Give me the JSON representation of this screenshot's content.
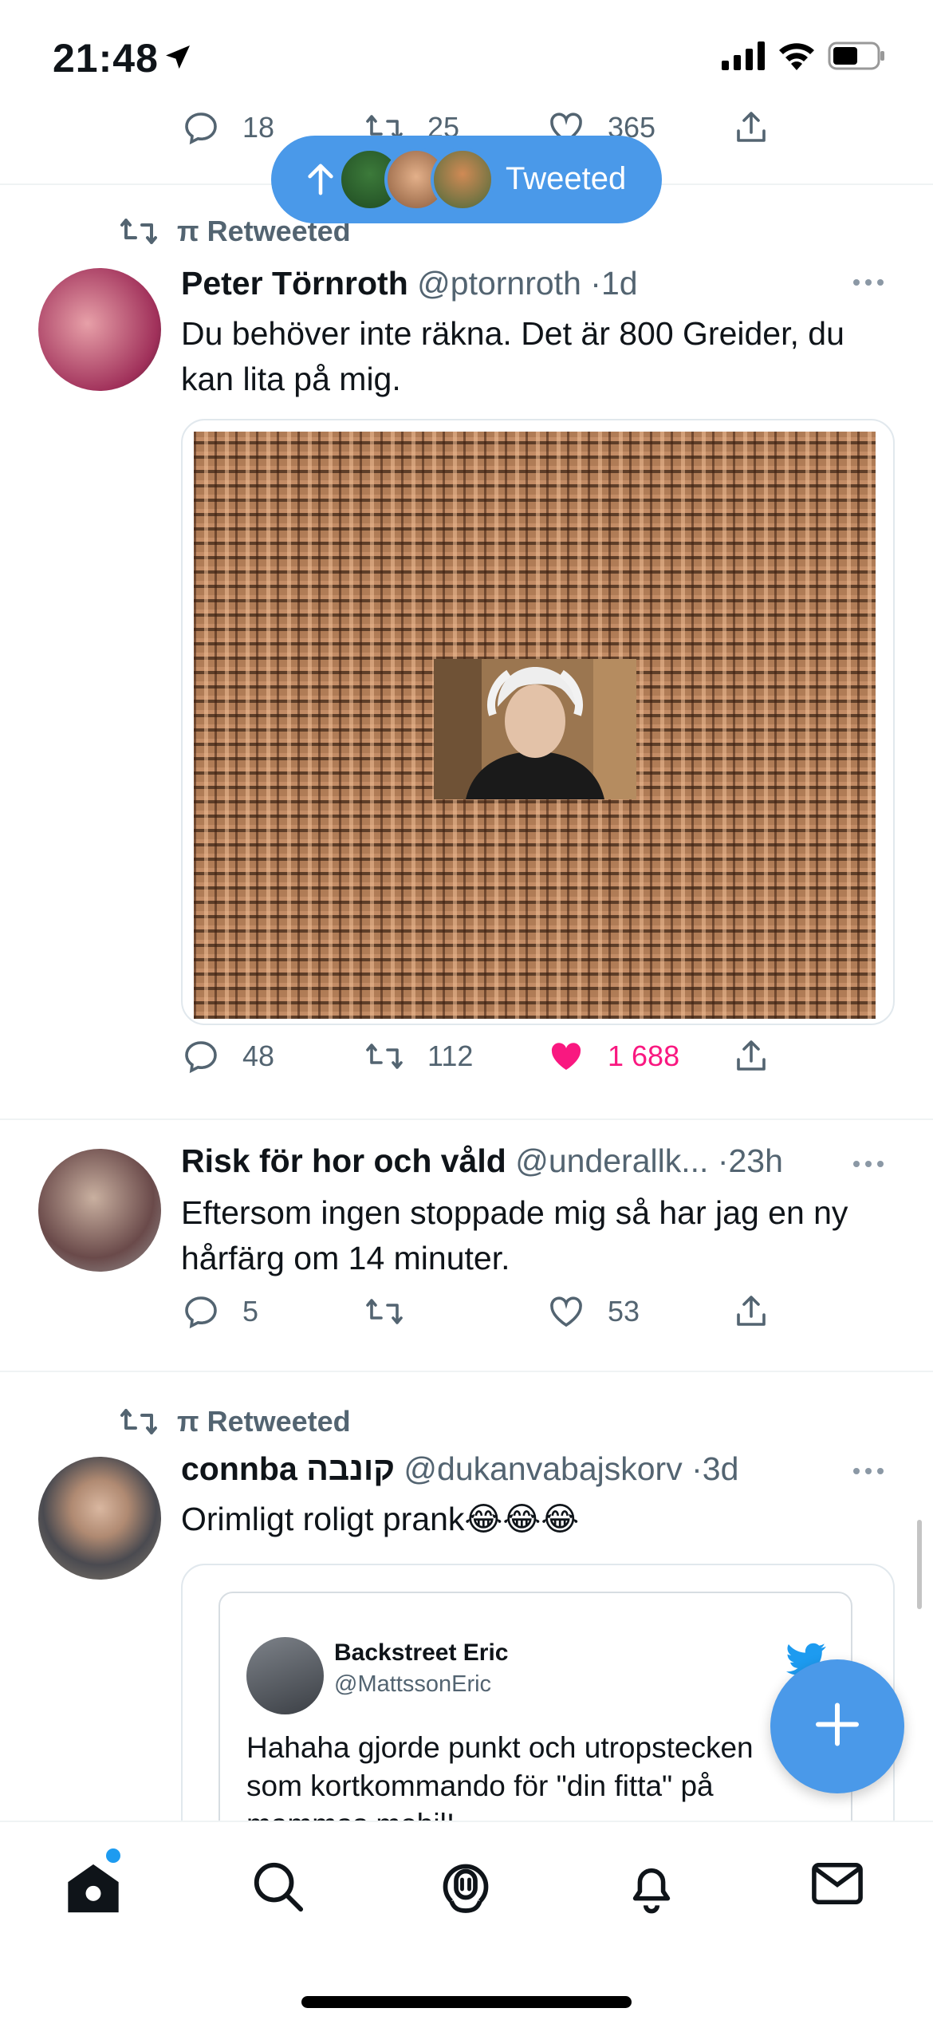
{
  "status_bar": {
    "time": "21:48"
  },
  "top_stats": {
    "replies": "18",
    "retweets": "25",
    "likes": "365"
  },
  "new_tweets_pill": {
    "label": "Tweeted"
  },
  "tweets": [
    {
      "retweeted_by": "π Retweeted",
      "name": "Peter Törnroth",
      "handle": "@ptornroth",
      "time": "1d",
      "text": "Du behöver inte räkna. Det är 800 Greider, du kan lita på mig.",
      "replies": "48",
      "retweets": "112",
      "likes": "1 688"
    },
    {
      "name": "Risk för hor och våld",
      "handle": "@underallk...",
      "time": "23h",
      "text": "Eftersom ingen stoppade mig så har jag en ny hårfärg om 14 minuter.",
      "replies": "5",
      "retweets": "",
      "likes": "53"
    },
    {
      "retweeted_by": "π Retweeted",
      "name": "connba קונבה",
      "handle": "@dukanvabajskorv",
      "time": "3d",
      "text": "Orimligt roligt prank😂😂😂",
      "quote": {
        "name": "Backstreet Eric",
        "handle": "@MattssonEric",
        "text": "Hahaha gjorde punkt och utropstecken som kortkommando för \"din fitta\" på mammas mobil!"
      }
    }
  ],
  "icons": [
    "location-arrow-icon",
    "signal-icon",
    "wifi-icon",
    "battery-icon",
    "reply-icon",
    "retweet-icon",
    "like-icon",
    "share-icon",
    "more-icon",
    "compose-icon",
    "home-icon",
    "search-icon",
    "spaces-icon",
    "notifications-icon",
    "messages-icon",
    "twitter-bird-icon"
  ],
  "colors": {
    "accent": "#1d9bf0",
    "pill": "#4a99e9",
    "like": "#f91880",
    "muted": "#536471"
  }
}
